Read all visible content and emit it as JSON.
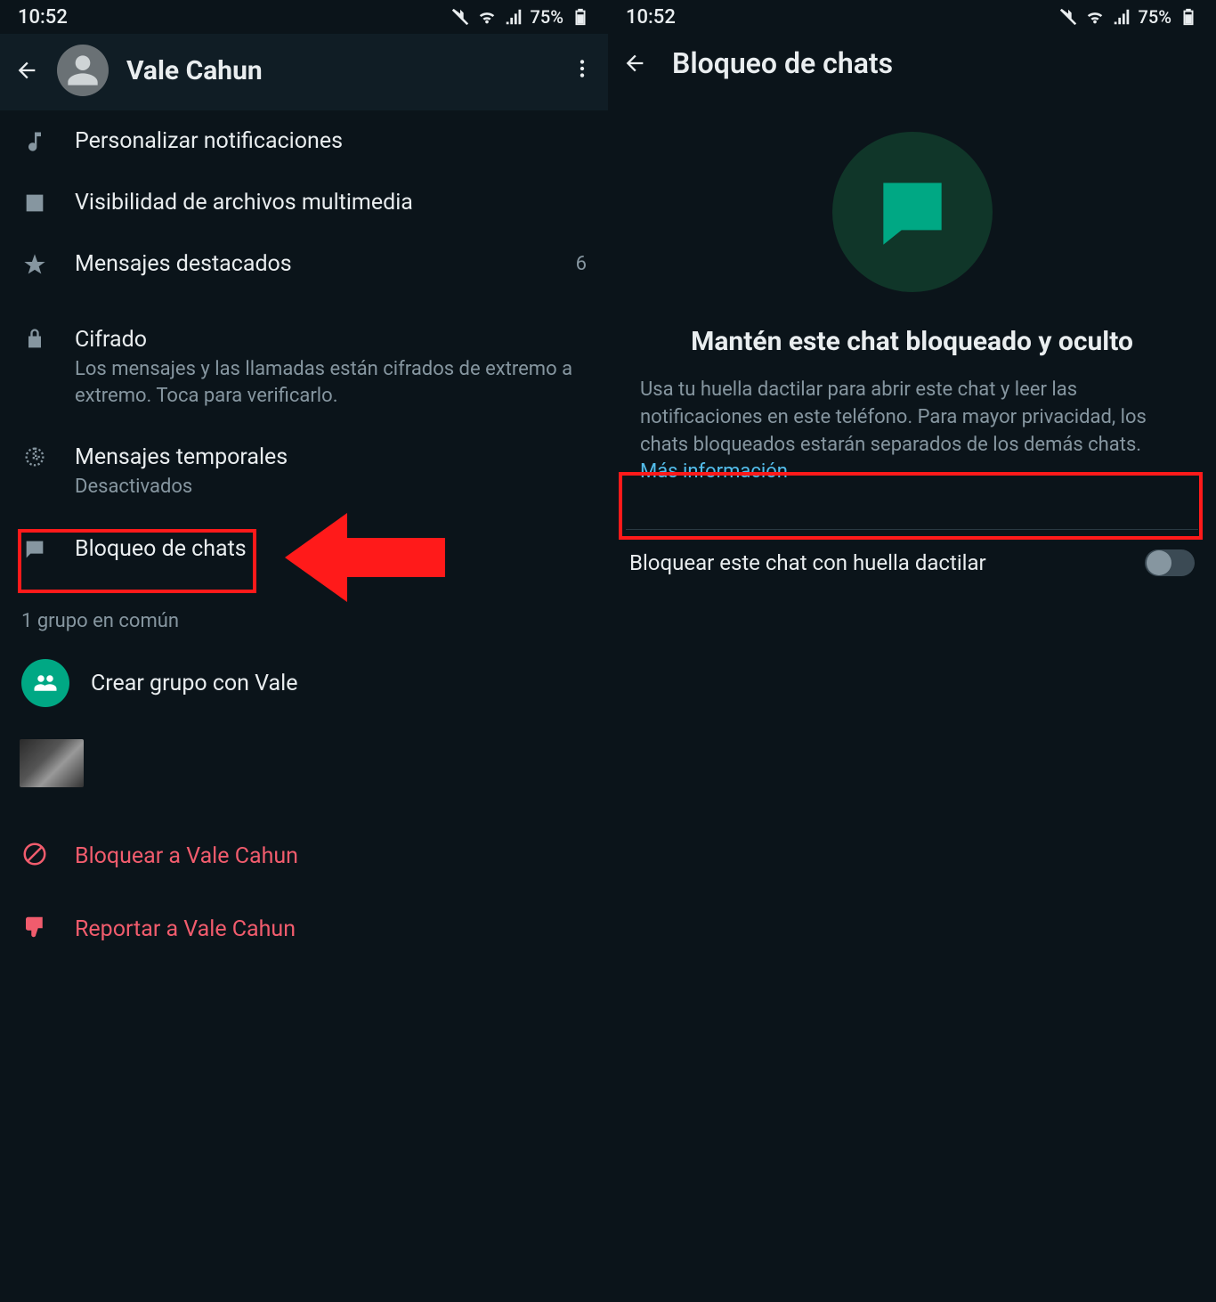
{
  "status": {
    "time": "10:52",
    "battery": "75%"
  },
  "left": {
    "contact_name": "Vale Cahun",
    "rows": {
      "notifications": "Personalizar notificaciones",
      "media": "Visibilidad de archivos multimedia",
      "starred": "Mensajes destacados",
      "starred_count": "6",
      "encryption_title": "Cifrado",
      "encryption_sub": "Los mensajes y las llamadas están cifrados de extremo a extremo. Toca para verificarlo.",
      "temp_title": "Mensajes temporales",
      "temp_sub": "Desactivados",
      "chatlock": "Bloqueo de chats",
      "group_caption": "1 grupo en común",
      "create_group": "Crear grupo con Vale",
      "block": "Bloquear a Vale Cahun",
      "report": "Reportar a Vale Cahun"
    }
  },
  "right": {
    "title": "Bloqueo de chats",
    "hero_title": "Mantén este chat bloqueado y oculto",
    "hero_desc": "Usa tu huella dactilar para abrir este chat y leer las notificaciones en este teléfono. Para mayor privacidad, los chats bloqueados estarán separados de los demás chats. ",
    "hero_link": "Más información",
    "toggle_label": "Bloquear este chat con huella dactilar"
  }
}
